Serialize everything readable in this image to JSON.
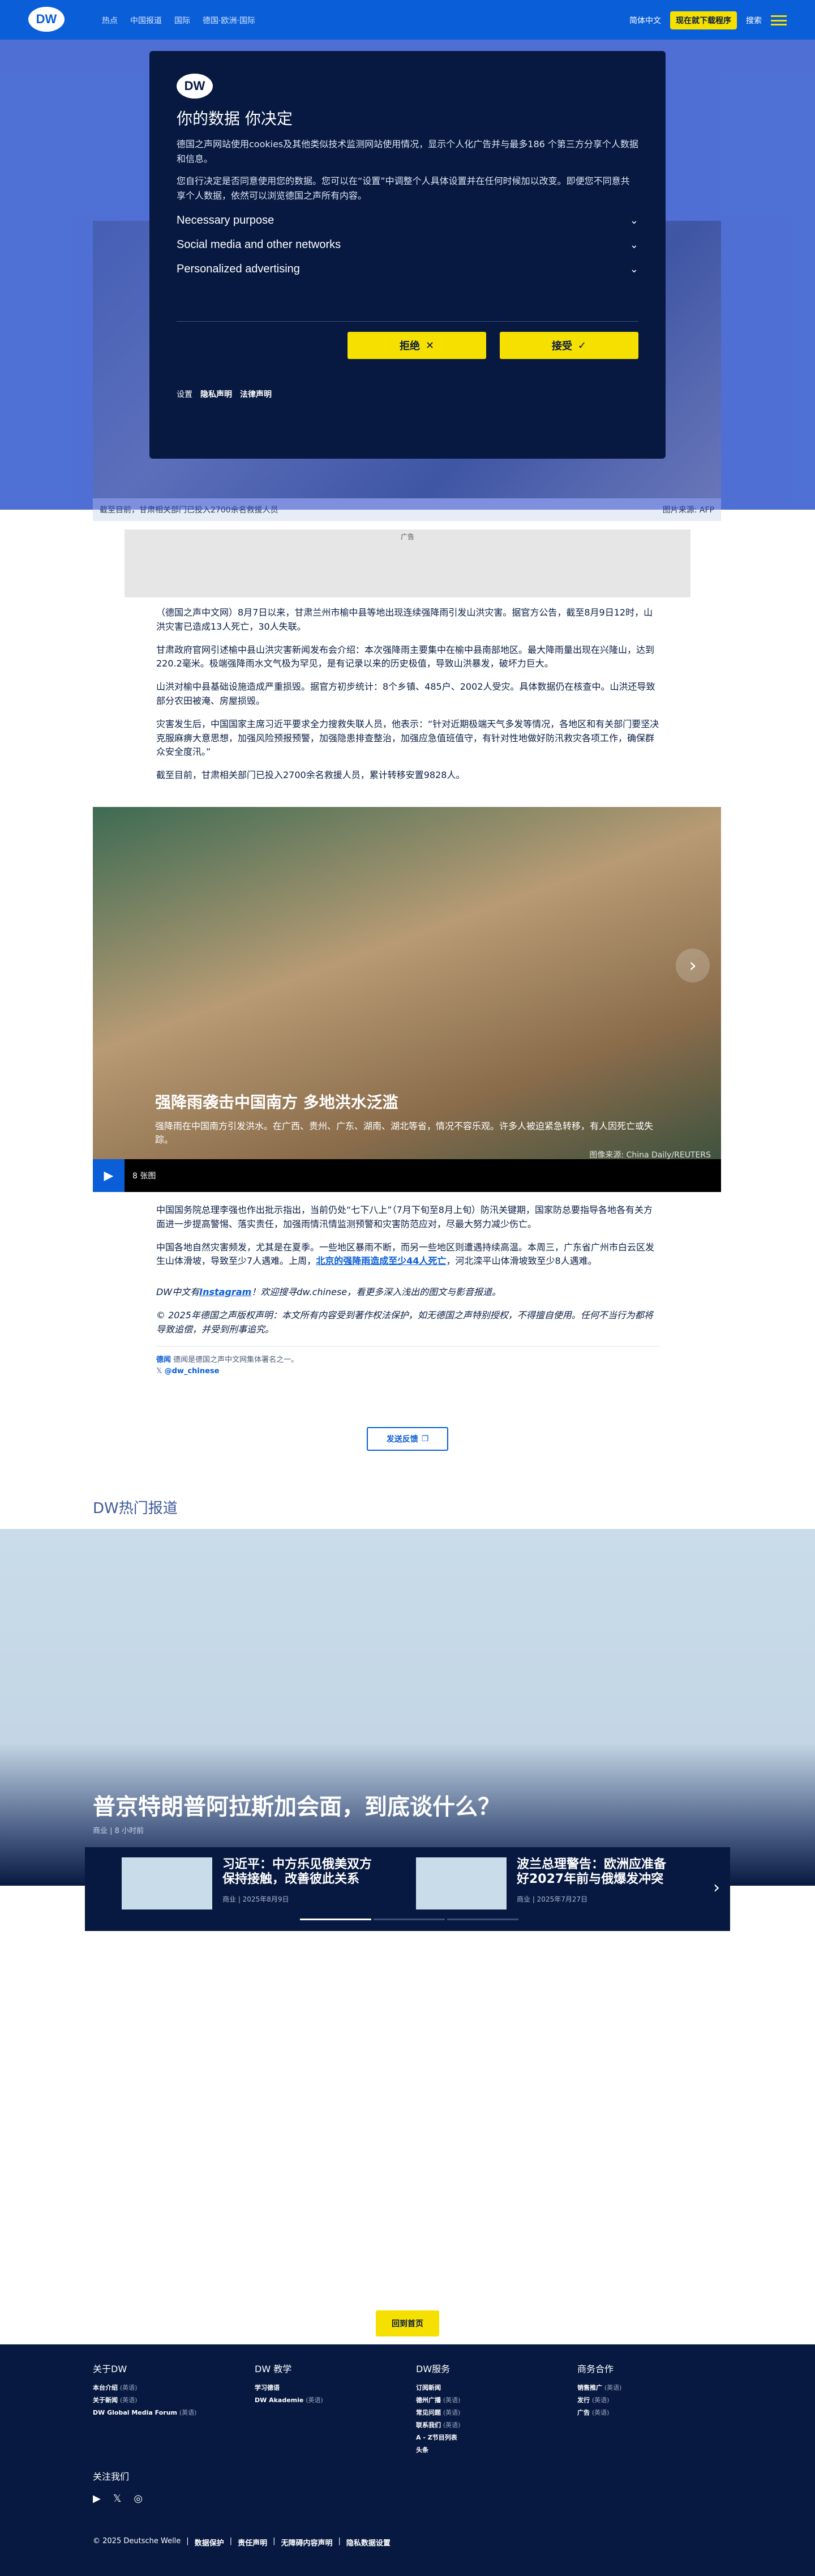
{
  "topbar": {
    "logo": "DW",
    "nav": [
      "热点",
      "中国报道",
      "国际",
      "德国·欧洲·国际"
    ],
    "right": [
      "简体中文",
      "现在就下载程序",
      "搜索"
    ],
    "yellow_pill": "现在就下载程序"
  },
  "hero": {
    "caption": "截至目前，甘肃相关部门已投入2700余名救援人员",
    "credit": "图片来源: AFP"
  },
  "consent": {
    "logo": "DW",
    "title": "你的数据 你决定",
    "p1": "德国之声网站使用cookies及其他类似技术监测网站使用情况，显示个人化广告并与最多186 个第三方分享个人数据和信息。",
    "p2": "您自行决定是否同意使用您的数据。您可以在“设置”中调整个人具体设置并在任何时候加以改变。即便您不同意共享个人数据，依然可以浏览德国之声所有内容。",
    "purposes": [
      "Necessary purpose",
      "Social media and other networks",
      "Personalized advertising"
    ],
    "reject": "拒绝",
    "accept": "接受",
    "links": [
      "设置",
      "隐私声明",
      "法律声明"
    ]
  },
  "ad": {
    "label": "广告"
  },
  "article": {
    "paragraphs": [
      "（德国之声中文网）8月7日以来，甘肃兰州市榆中县等地出现连续强降雨引发山洪灾害。据官方公告，截至8月9日12时，山洪灾害已造成13人死亡，30人失联。",
      "甘肃政府官网引述榆中县山洪灾害新闻发布会介绍：本次强降雨主要集中在榆中县南部地区。最大降雨量出现在兴隆山，达到220.2毫米。极端强降雨水文气极为罕见，是有记录以来的历史极值，导致山洪暴发，破坏力巨大。",
      "山洪对榆中县基础设施造成严重损毁。据官方初步统计：8个乡镇、485户、2002人受灾。具体数据仍在核查中。山洪还导致部分农田被淹、房屋损毁。",
      "灾害发生后，中国国家主席习近平要求全力搜救失联人员，他表示：“针对近期极端天气多发等情况，各地区和有关部门要坚决克服麻痹大意思想，加强风险预报预警，加强隐患排查整治，加强应急值班值守，有针对性地做好防汛救灾各项工作，确保群众安全度汛。”",
      "截至目前，甘肃相关部门已投入2700余名救援人员，累计转移安置9828人。"
    ]
  },
  "gallery": {
    "title": "强降雨袭击中国南方 多地洪水泛滥",
    "desc": "强降雨在中国南方引发洪水。在广西、贵州、广东、湖南、湖北等省，情况不容乐观。许多人被迫紧急转移，有人因死亡或失踪。",
    "credit": "图像来源: China Daily/REUTERS",
    "count": "8 张图"
  },
  "article2": {
    "p1": "中国国务院总理李强也作出批示指出，当前仍处“七下八上”（7月下旬至8月上旬）防汛关键期，国家防总要指导各地各有关方面进一步提高警惕、落实责任，加强雨情汛情监测预警和灾害防范应对，尽最大努力减少伤亡。",
    "p2a": "中国各地自然灾害频发，尤其是在夏季。一些地区暴雨不断，而另一些地区则遭遇持续高温。本周三，广东省广州市白云区发生山体滑坡，导致至少7人遇难。上周，",
    "p2link": "北京的强降雨造成至少44人死亡",
    "p2b": "，河北滦平山体滑坡致至少8人遇难。",
    "ins_a": "DW中文有",
    "ins_link": "Instagram",
    "ins_b": "！欢迎搜寻dw.chinese，看更多深入浅出的图文与影音报道。",
    "copyright": "© 2025年德国之声版权声明：本文所有内容受到著作权法保护，如无德国之声特别授权，不得擅自使用。任何不当行为都将导致追偿，并受到刑事追究。",
    "tag_label": "德闻",
    "tag_text": "德闻是德国之声中文网集体署名之一。",
    "handle": "@dw_chinese",
    "feedback": "发送反馈"
  },
  "highlights": {
    "section": "DW热门报道",
    "title": "普京特朗普阿拉斯加会面，到底谈什么？",
    "meta": "商业 | 8 小时前",
    "cards": [
      {
        "title": "习近平：中方乐见俄美双方保持接触，改善彼此关系",
        "meta": "商业 | 2025年8月9日"
      },
      {
        "title": "波兰总理警告：欧洲应准备好2027年前与俄爆发冲突",
        "meta": "商业 | 2025年7月27日"
      }
    ]
  },
  "backtop": "回到首页",
  "footer": {
    "cols": [
      {
        "title": "关于DW",
        "items": [
          [
            "本台介绍",
            "(英语)"
          ],
          [
            "关于新闻",
            "(英语)"
          ],
          [
            "DW Global Media Forum",
            "(英语)"
          ]
        ]
      },
      {
        "title": "DW 教学",
        "items": [
          [
            "学习德语",
            ""
          ],
          [
            "DW Akademie",
            "(英语)"
          ]
        ]
      },
      {
        "title": "DW服务",
        "items": [
          [
            "订阅新闻",
            ""
          ],
          [
            "德州广播",
            "(英语)"
          ],
          [
            "常见问题",
            "(英语)"
          ],
          [
            "联系我们",
            "(英语)"
          ],
          [
            "A - Z节目列表",
            ""
          ],
          [
            "头条",
            ""
          ]
        ]
      },
      {
        "title": "商务合作",
        "items": [
          [
            "销售推广",
            "(英语)"
          ],
          [
            "发行",
            "(英语)"
          ],
          [
            "广告",
            "(英语)"
          ]
        ]
      }
    ],
    "follow": "关注我们",
    "copyright": "© 2025 Deutsche Welle",
    "links": [
      "数据保护",
      "责任声明",
      "无障碍内容声明",
      "隐私数据设置"
    ]
  }
}
